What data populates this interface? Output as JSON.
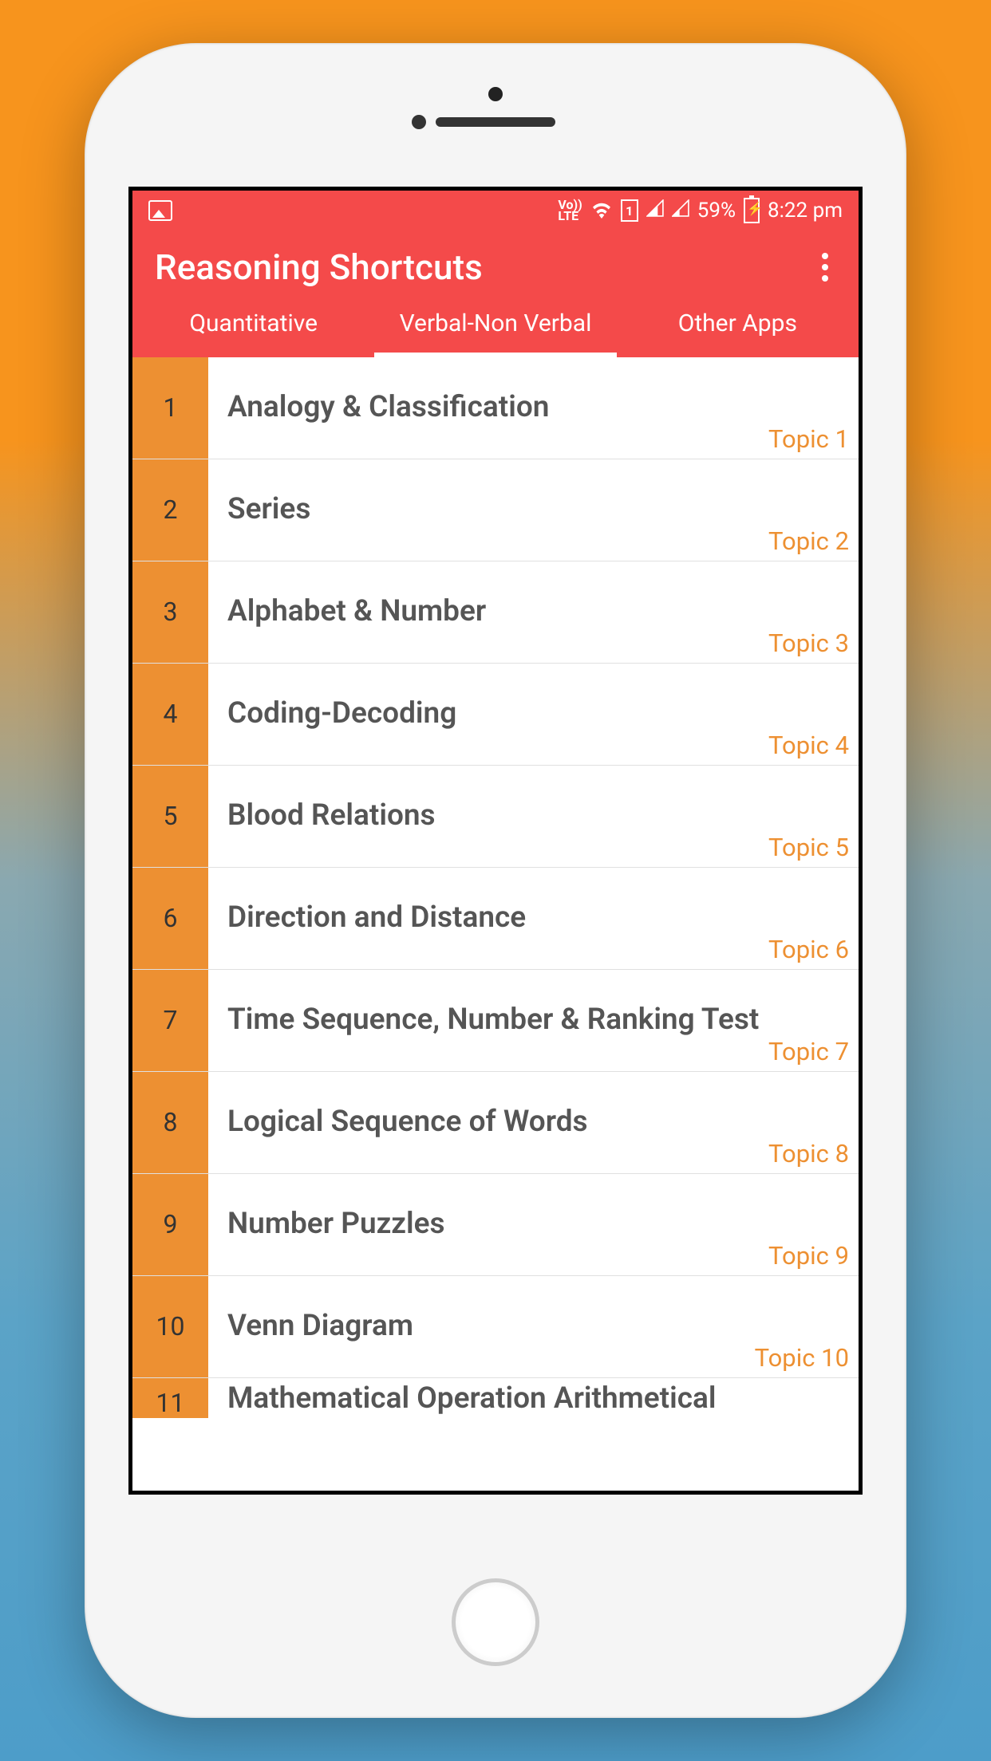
{
  "status": {
    "volte": "Vo))\nLTE",
    "sim": "1",
    "battery_pct": "59%",
    "time": "8:22 pm"
  },
  "header": {
    "title": "Reasoning Shortcuts"
  },
  "tabs": [
    {
      "label": "Quantitative",
      "active": false
    },
    {
      "label": "Verbal-Non Verbal",
      "active": true
    },
    {
      "label": "Other Apps",
      "active": false
    }
  ],
  "topics": [
    {
      "num": "1",
      "title": "Analogy & Classification",
      "topic": "Topic 1"
    },
    {
      "num": "2",
      "title": "Series",
      "topic": "Topic 2"
    },
    {
      "num": "3",
      "title": "Alphabet & Number",
      "topic": "Topic 3"
    },
    {
      "num": "4",
      "title": "Coding-Decoding",
      "topic": "Topic 4"
    },
    {
      "num": "5",
      "title": "Blood Relations",
      "topic": "Topic 5"
    },
    {
      "num": "6",
      "title": "Direction and Distance",
      "topic": "Topic 6"
    },
    {
      "num": "7",
      "title": "Time Sequence, Number & Ranking Test",
      "topic": "Topic 7"
    },
    {
      "num": "8",
      "title": "Logical Sequence of Words",
      "topic": "Topic 8"
    },
    {
      "num": "9",
      "title": "Number Puzzles",
      "topic": "Topic 9"
    },
    {
      "num": "10",
      "title": "Venn Diagram",
      "topic": "Topic 10"
    },
    {
      "num": "11",
      "title": "Mathematical Operation Arithmetical",
      "topic": ""
    }
  ],
  "colors": {
    "accent_red": "#F44A4A",
    "accent_orange": "#ED9032"
  }
}
